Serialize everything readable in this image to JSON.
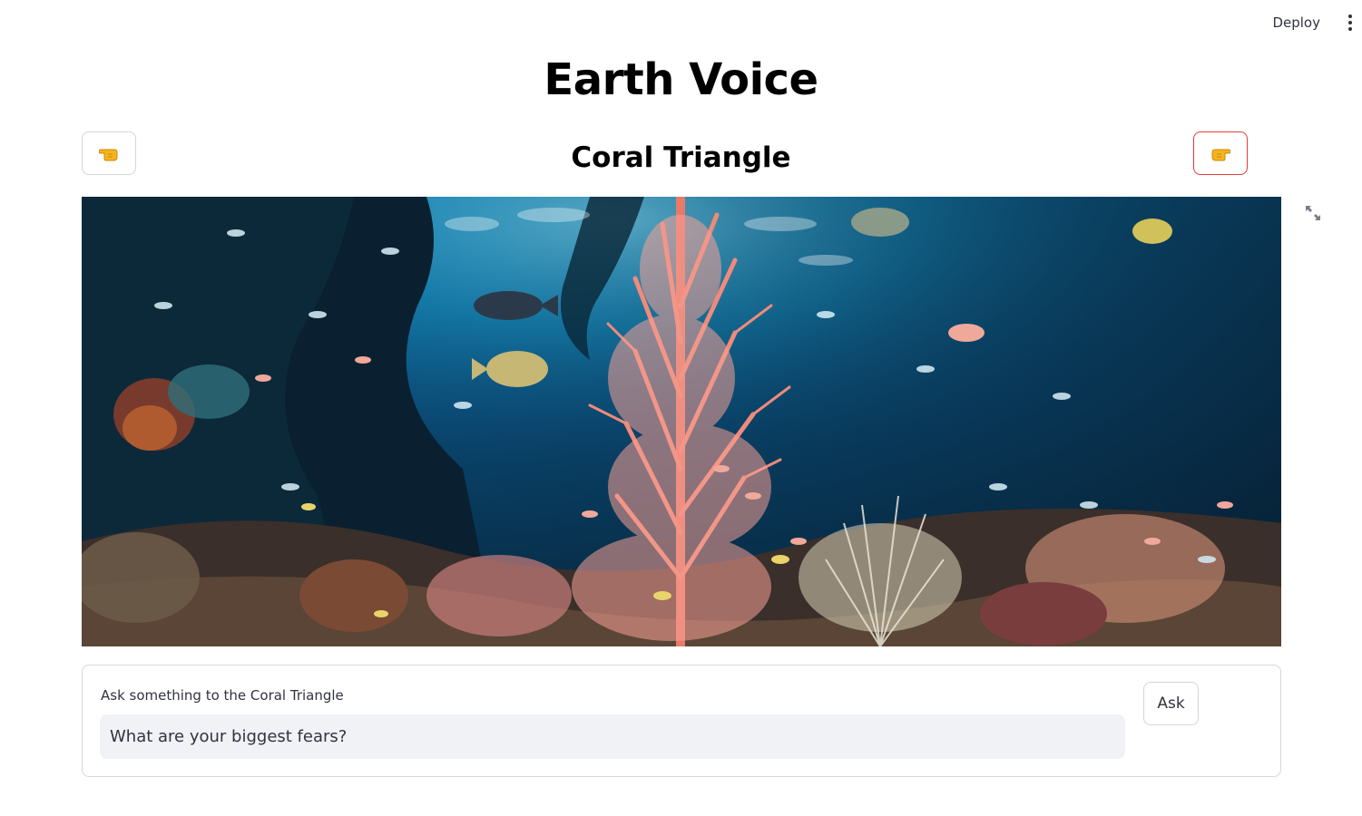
{
  "toolbar": {
    "deploy_label": "Deploy",
    "menu_icon": "vertical-dots-icon"
  },
  "header": {
    "title": "Earth Voice"
  },
  "location": {
    "name": "Coral Triangle",
    "prev_icon": "hand-pointing-left-icon",
    "next_icon": "hand-pointing-right-icon"
  },
  "image": {
    "alt": "Coral Triangle",
    "fullscreen_icon": "expand-icon"
  },
  "ask": {
    "label": "Ask something to the Coral Triangle",
    "value": "What are your biggest fears?",
    "button_label": "Ask"
  },
  "colors": {
    "next_border": "#e33b3b",
    "input_bg": "#f0f2f6",
    "text": "#31333f"
  }
}
